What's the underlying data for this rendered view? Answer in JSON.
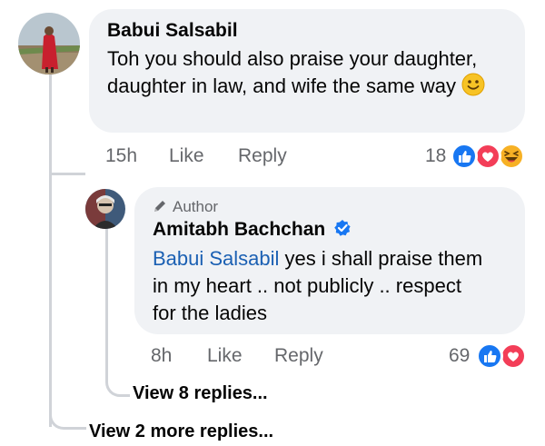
{
  "comment": {
    "author": "Babui Salsabil",
    "text": "Toh you should also praise your daughter, daughter in law, and wife the same way",
    "emoji": "🙂",
    "time": "15h",
    "like_label": "Like",
    "reply_label": "Reply",
    "reaction_count": "18",
    "reaction_icons": [
      "like-icon",
      "love-icon",
      "haha-icon"
    ]
  },
  "reply": {
    "badge": "Author",
    "author": "Amitabh Bachchan",
    "verified_icon": "verified-badge-icon",
    "mention": "Babui Salsabil",
    "text": " yes i shall praise them in my heart .. not publicly .. respect for the ladies",
    "time": "8h",
    "like_label": "Like",
    "reply_label": "Reply",
    "reaction_count": "69",
    "reaction_icons": [
      "like-icon",
      "love-icon"
    ]
  },
  "view_nested_replies": "View 8 replies...",
  "view_more_replies": "View 2 more replies...",
  "colors": {
    "bubble": "#f0f2f5",
    "mention": "#1b60b3",
    "like": "#1877f2",
    "love": "#f33e58",
    "haha": "#f7b125",
    "meta": "#65676b"
  }
}
